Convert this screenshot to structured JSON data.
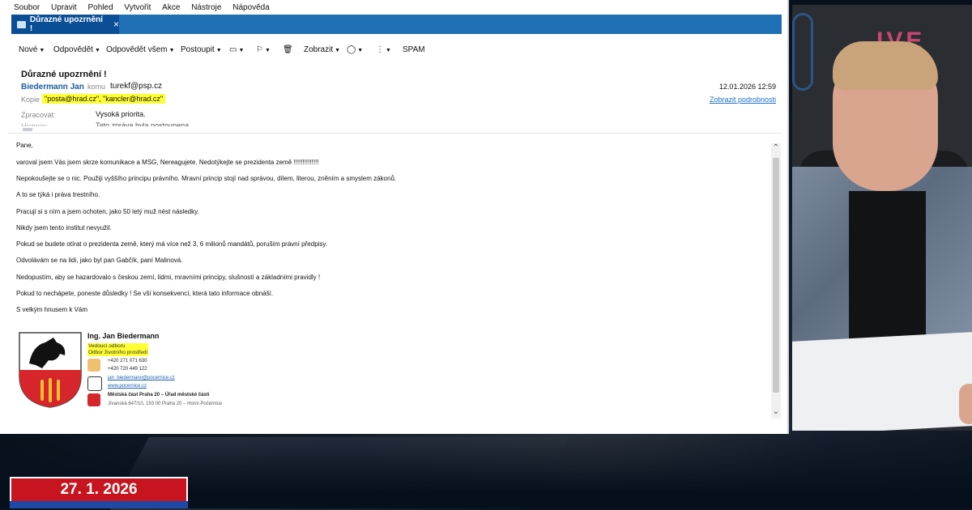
{
  "menubar": [
    "Soubor",
    "Upravit",
    "Pohled",
    "Vytvořit",
    "Akce",
    "Nástroje",
    "Nápověda"
  ],
  "tab": {
    "title": "Důrazné upozrnění !",
    "close": "×"
  },
  "toolbar": {
    "new": "Nové",
    "reply": "Odpovědět",
    "reply_all": "Odpovědět všem",
    "forward": "Postoupit",
    "show": "Zobrazit",
    "spam": "SPAM"
  },
  "header": {
    "subject": "Důrazné upozrnění !",
    "from": "Biedermann Jan",
    "to_label": "komu",
    "to": "turekf@psp.cz",
    "date": "12.01.2026 12:59",
    "cc_label": "Kopie",
    "cc": "\"posta@hrad.cz\", \"kancler@hrad.cz\"",
    "details_link": "Zobrazit podrobnosti",
    "processing_label": "Zpracovat:",
    "processing_value": "Vysoká priorita.",
    "history_label": "Historie:",
    "history_value": "Tato zpráva byla postoupena"
  },
  "body": {
    "lines": [
      "Pane,",
      "varoval jsem Vás jsem skrze komunikace a MSG, Nereagujete. Nedotýkejte se prezidenta země !!!!!!!!!!!!!!",
      "Nepokoušejte se o nic. Použiji vyššího principu právního. Mravní princip stojí nad správou, dílem, literou, zněním a smyslem zákonů.",
      "A to se týká i práva trestního.",
      "Pracuji si s ním a jsem ochoten, jako 50 letý muž nést následky.",
      "Nikdy jsem tento institut nevyužil.",
      "Pokud se budete otírat o prezidenta země, který má více než 3, 6 milionů mandátů, poruším právní předpisy.",
      "Odvolávám se na lidi, jako byl pan Gabčík, paní Malinová.",
      "Nedopustím, aby se hazardovalo s českou zemí, lidmi, mravními principy, slušností a základními pravidly !",
      "Pokud to nechápete, poneste důsledky ! Se vší konsekvencí, která tato informace obnáší.",
      "S velkým hnusem k Vám"
    ]
  },
  "signature": {
    "name": "Ing. Jan Biedermann",
    "role_1": "Vedoucí odboru",
    "role_2": "Odbor životního prostředí",
    "phone_1": "+420 271 071 630",
    "phone_2": "+420 720 449 122",
    "email": "jan_biedermann@pocernice.cz",
    "web": "www.pocernice.cz",
    "office": "Městská část Praha 20 – Úřad městské části",
    "address": "Jívanská 647/10, 193 00 Praha 20 – Horní Počernice"
  },
  "broadcast": {
    "neon_text": "IVE",
    "date_badge": "27. 1. 2026"
  },
  "colors": {
    "tab_bar": "#1f6fb5",
    "active_tab": "#0a4f96",
    "highlight": "#ffff33",
    "sender": "#1a5a9c",
    "badge_red": "#c8141e"
  }
}
